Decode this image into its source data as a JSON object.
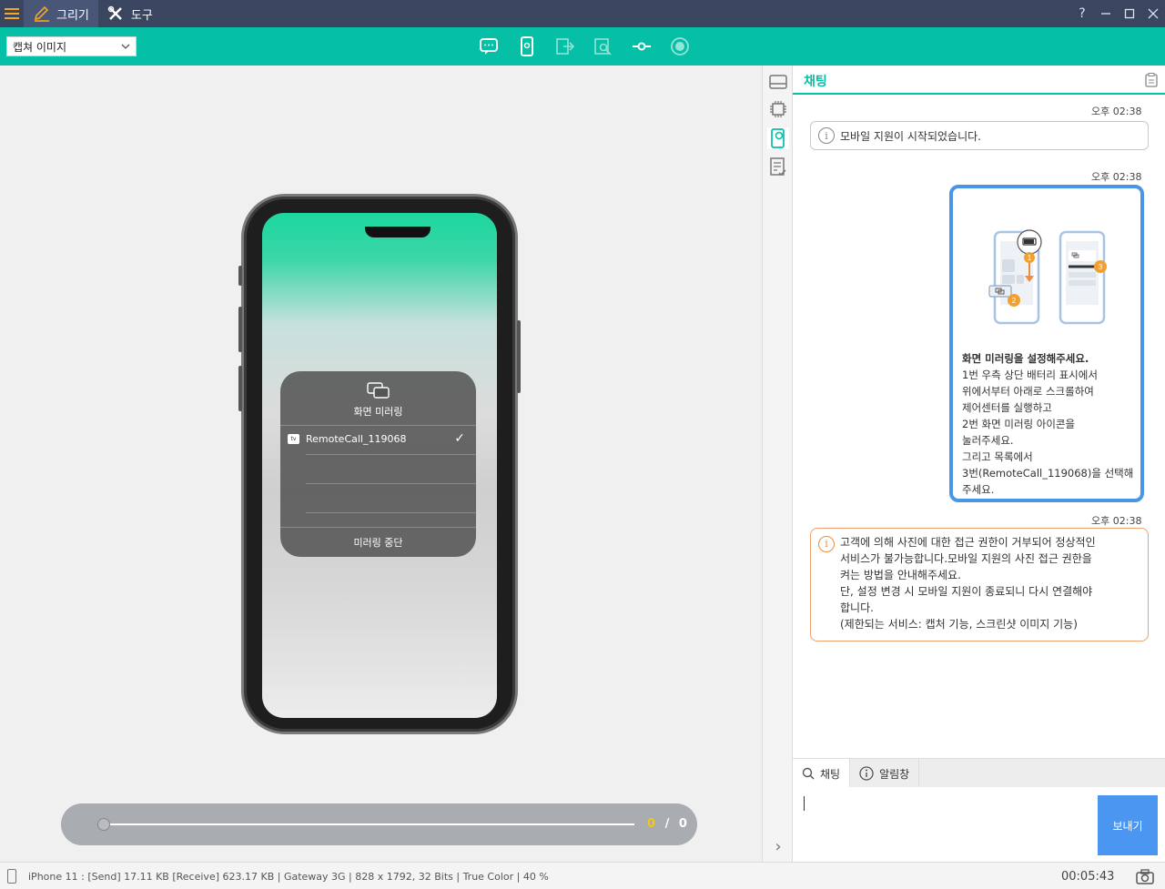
{
  "titlebar": {
    "tabs": [
      {
        "label": "그리기",
        "icon": "pencil-icon"
      },
      {
        "label": "도구",
        "icon": "tools-icon"
      }
    ],
    "buttons": {
      "help": "?",
      "minimize": "—",
      "maximize": "☐",
      "close": "✕"
    }
  },
  "toolbar": {
    "select_value": "캡쳐 이미지",
    "icons": [
      "chat-bubble-icon",
      "mobile-device-icon",
      "exit-icon",
      "zoom-doc-icon",
      "link-icon",
      "record-icon"
    ]
  },
  "phone_screen": {
    "mirroring_title": "화면 미러링",
    "device_name": "RemoteCall_119068",
    "tv_badge": "tv",
    "check": "✓",
    "stop_label": "미러링 중단"
  },
  "playback": {
    "current": "0",
    "separator": "/",
    "total": "0"
  },
  "side_strip": {
    "icons": [
      "drive-icon",
      "chip-icon",
      "mobile-support-icon",
      "checklist-icon"
    ],
    "collapse": "›"
  },
  "chat": {
    "title": "채팅",
    "messages": [
      {
        "time": "오후 02:38",
        "text": "모바일 지원이 시작되었습니다."
      },
      {
        "time": "오후 02:38",
        "guide_title": "화면 미러링을 설정해주세요.",
        "lines": [
          "1번 우측 상단 배터리 표시에서",
          "위에서부터 아래로 스크롤하여",
          "제어센터를 실행하고",
          "2번 화면 미러링 아이콘을",
          "눌러주세요.",
          "그리고 목록에서",
          "3번(RemoteCall_119068)을 선택해",
          "주세요."
        ],
        "badges": [
          "1",
          "2",
          "3"
        ]
      },
      {
        "time": "오후 02:38",
        "lines": [
          "고객에 의해 사진에 대한 접근 권한이 거부되어 정상적인",
          "서비스가 불가능합니다.모바일 지원의 사진 접근 권한을",
          "켜는 방법을 안내해주세요.",
          "단, 설정 변경 시 모바일 지원이 종료되니 다시 연결해야",
          "합니다.",
          "(제한되는 서비스: 캡처 기능, 스크린샷 이미지 기능)"
        ]
      }
    ],
    "tabs": [
      {
        "label": "채팅",
        "icon": "search-icon"
      },
      {
        "label": "알림창",
        "icon": "info-icon"
      }
    ],
    "input_value": "",
    "send_label": "보내기"
  },
  "statusbar": {
    "text": "iPhone 11 : [Send] 17.11 KB   [Receive] 623.17 KB | Gateway 3G | 828 x 1792, 32 Bits | True Color | 40 %",
    "elapsed": "00:05:43"
  },
  "colors": {
    "accent": "#05bfa6",
    "titlebar": "#3a4560",
    "send": "#4a96f0",
    "warning": "#f08c3a",
    "orange_badge": "#f0a030"
  }
}
